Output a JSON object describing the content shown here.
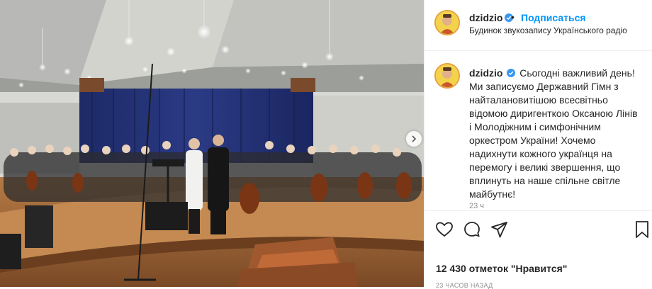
{
  "post": {
    "username": "dzidzio",
    "follow_label": "Подписаться",
    "separator": "•",
    "location": "Будинок звукозапису Українського радіо",
    "caption": {
      "username": "dzidzio",
      "text": "Сьогодні важливий день! Ми записуємо Державний Гімн з найталановитішою всесвітньо відомою диригенткою Оксаною Лінів і Молодіжним і симфонічним оркестром України! Хочемо надихнути кожного українця на перемогу і великі звершення, що вплинуть на наше спільне світле майбутнє!"
    },
    "comment_time_partial": "23 ч",
    "likes": "12 430 отметок \"Нравится\"",
    "posted_ago": "23 часов назад"
  },
  "icons": {
    "like": "heart-icon",
    "comment": "comment-icon",
    "share": "share-icon",
    "save": "bookmark-icon",
    "next": "chevron-right-icon",
    "verified": "verified-badge-icon"
  },
  "colors": {
    "link": "#0095f6",
    "verified": "#3897f0",
    "text": "#262626",
    "muted": "#8e8e8e",
    "avatar_ring": "#e8a13a"
  }
}
